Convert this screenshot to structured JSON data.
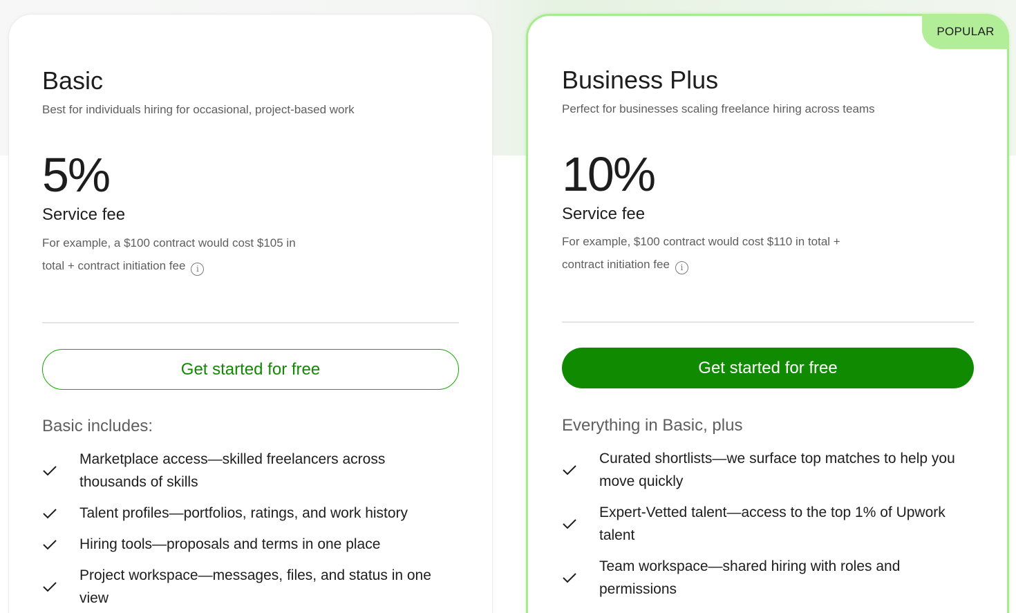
{
  "plans": [
    {
      "name": "Basic",
      "subtitle": "Best for individuals hiring for occasional, project-based work",
      "price": "5%",
      "fee_label": "Service fee",
      "fee_desc_line1": "For example, a $100 contract would cost $105 in",
      "fee_desc_line2": "total + contract initiation fee",
      "cta": "Get started for free",
      "includes_title": "Basic includes:",
      "features": [
        "Marketplace access—skilled freelancers across thousands of skills",
        "Talent profiles—portfolios, ratings, and work history",
        "Hiring tools—proposals and terms in one place",
        "Project workspace—messages, files, and status in one view"
      ]
    },
    {
      "name": "Business Plus",
      "badge": "POPULAR",
      "subtitle": "Perfect for businesses scaling freelance hiring across teams",
      "price": "10%",
      "fee_label": "Service fee",
      "fee_desc_line1": "For example, $100 contract would cost $110 in total +",
      "fee_desc_line2": "contract initiation fee",
      "cta": "Get started for free",
      "includes_title": "Everything in Basic, plus",
      "features": [
        "Curated shortlists—we surface top matches to help you move quickly",
        "Expert-Vetted talent—access to the top 1% of Upwork talent",
        "Team workspace—shared hiring with roles and permissions"
      ]
    }
  ],
  "icons": {
    "info": "info-icon",
    "check": "check-icon"
  },
  "colors": {
    "accent": "#108a00",
    "popular_badge": "#b2ee97",
    "card_border_highlight": "#a6ec8e"
  }
}
